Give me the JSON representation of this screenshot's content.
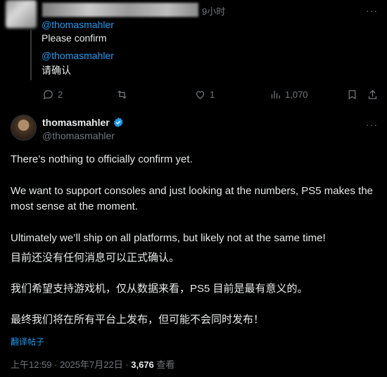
{
  "reply": {
    "time": "9小时",
    "mention_1": "@thomasmahler",
    "text_1": "Please confirm",
    "mention_2": "@thomasmahler",
    "text_2": "请确认"
  },
  "actions": {
    "replies": "2",
    "likes": "1",
    "views": "1,070"
  },
  "tweet": {
    "author_name": "thomasmahler",
    "author_handle": "@thomasmahler",
    "p1": "There’s nothing to officially confirm yet.",
    "p2": "We want to support consoles and just looking at the numbers, PS5 makes the most sense at the moment.",
    "p3": "Ultimately we’ll ship on all platforms, but likely not at the same time!",
    "p4": "目前还没有任何消息可以正式确认。",
    "p5": "我们希望支持游戏机，仅从数据来看，PS5 目前是最有意义的。",
    "p6": "最终我们将在所有平台上发布，但可能不会同时发布！",
    "translate_label": "翻译帖子",
    "timestamp": "上午12:59 · 2025年7月22日 · ",
    "view_count": "3,676",
    "view_label": " 查看"
  },
  "colors": {
    "accent": "#1d9bf0",
    "muted": "#71767b",
    "background": "#000000"
  }
}
